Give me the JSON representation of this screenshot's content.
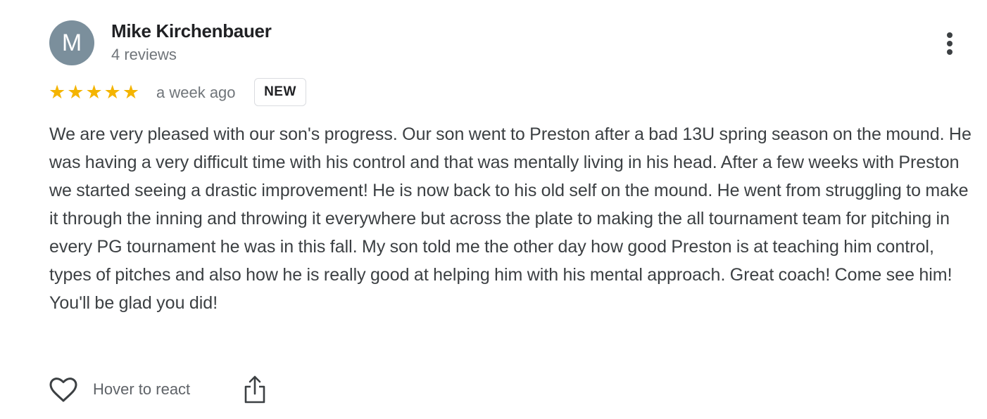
{
  "review": {
    "author": {
      "initial": "M",
      "name": "Mike Kirchenbauer",
      "meta": "4 reviews"
    },
    "rating": 5,
    "rating_max": 5,
    "star_color": "#f4b400",
    "avatar_color": "#7b8f9c",
    "time": "a week ago",
    "badge": "NEW",
    "text": "We are very pleased with our son's progress. Our son went to Preston after a bad 13U spring season on the mound. He was having a very difficult time with his control and that was mentally living in his head. After a few weeks with Preston we started seeing a drastic improvement! He is now back to his old self on the mound. He went from struggling to make it through the inning and throwing it everywhere but across the plate to making the all tournament team for pitching in every PG tournament he was in this fall. My son told me the other day how good Preston is at teaching him control, types of pitches and also how he is really good at helping him with his mental approach. Great coach! Come see him! You'll be glad you did!"
  },
  "actions": {
    "react_label": "Hover to react",
    "react_icon": "heart-outline-icon",
    "share_icon": "share-icon",
    "more_icon": "more-vertical-icon"
  }
}
